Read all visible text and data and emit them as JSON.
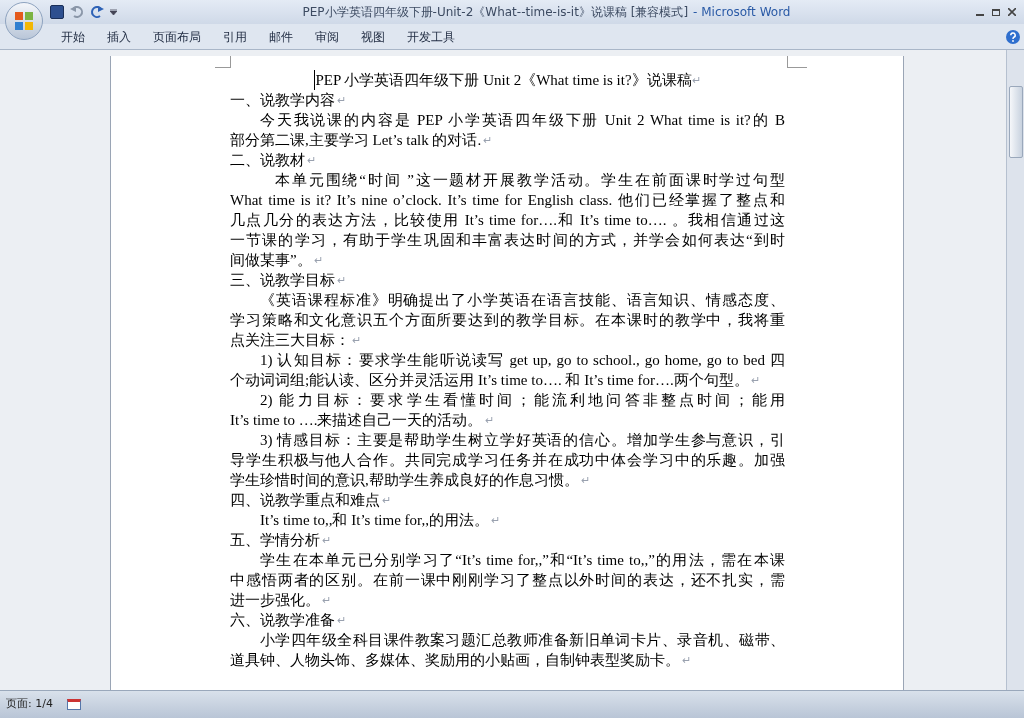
{
  "window": {
    "title": "PEP小学英语四年级下册-Unit-2《What--time-is-it》说课稿 [兼容模式]",
    "app_name": "- Microsoft Word"
  },
  "ribbon_tabs": [
    {
      "label": "开始",
      "selected": false
    },
    {
      "label": "插入",
      "selected": false
    },
    {
      "label": "页面布局",
      "selected": false
    },
    {
      "label": "引用",
      "selected": false
    },
    {
      "label": "邮件",
      "selected": false
    },
    {
      "label": "审阅",
      "selected": false
    },
    {
      "label": "视图",
      "selected": false
    },
    {
      "label": "开发工具",
      "selected": false
    }
  ],
  "document": {
    "paragraph_mark": "↵",
    "paragraphs": [
      {
        "kind": "title",
        "lines": [
          "PEP 小学英语四年级下册 Unit 2《What  time is it?》说课稿"
        ]
      },
      {
        "kind": "heading",
        "lines": [
          "一、说教学内容"
        ]
      },
      {
        "kind": "body",
        "lines": [
          "今天我说课的内容是  PEP  小学英语四年级下册 Unit 2  What  time is it?的  B",
          "部分第二课,主要学习 Let’s talk 的对话."
        ]
      },
      {
        "kind": "heading",
        "lines": [
          "二、说教材"
        ]
      },
      {
        "kind": "body_wide",
        "lines": [
          "本单元围绕“时间 ”这一题材开展教学活动。学生在前面课时学过句型",
          "What time is it? It’s nine o’clock. It’s time for English class. 他们已经掌握了整点和",
          "几点几分的表达方法，比较使用  It’s time for….和  It’s time to…. 。我相信通过这",
          "一节课的学习，有助于学生巩固和丰富表达时间的方式，并学会如何表达“到时",
          "间做某事”。"
        ]
      },
      {
        "kind": "heading",
        "lines": [
          "三、说教学目标"
        ]
      },
      {
        "kind": "body",
        "lines": [
          "《英语课程标准》明确提出了小学英语在语言技能、语言知识、情感态度、",
          "学习策略和文化意识五个方面所要达到的教学目标。在本课时的教学中，我将重",
          "点关注三大目标："
        ]
      },
      {
        "kind": "body",
        "lines": [
          "1) 认知目标：要求学生能听说读写 get up, go to school., go home, go to bed 四",
          "个动词词组;能认读、区分并灵活运用 It’s time to…. 和 It’s time for….两个句型。"
        ]
      },
      {
        "kind": "body",
        "lines": [
          "2) 能力目标：要求学生看懂时间；能流利地问答非整点时间；能用",
          "It’s time to ….来描述自己一天的活动。"
        ]
      },
      {
        "kind": "body",
        "lines": [
          "3) 情感目标：主要是帮助学生树立学好英语的信心。增加学生参与意识，引",
          "导学生积极与他人合作。共同完成学习任务并在成功中体会学习中的乐趣。加强",
          "学生珍惜时间的意识,帮助学生养成良好的作息习惯。"
        ]
      },
      {
        "kind": "heading",
        "lines": [
          "四、说教学重点和难点"
        ]
      },
      {
        "kind": "body",
        "lines": [
          "It’s time to,,和 It’s time for,,的用法。"
        ]
      },
      {
        "kind": "heading",
        "lines": [
          "五、学情分析"
        ]
      },
      {
        "kind": "body",
        "lines": [
          "学生在本单元已分别学习了“It’s time for,,”和“It’s time to,,”的用法，需在本课",
          "中感悟两者的区别。在前一课中刚刚学习了整点以外时间的表达，还不扎实，需",
          "进一步强化。"
        ]
      },
      {
        "kind": "heading",
        "lines": [
          "六、说教学准备"
        ]
      },
      {
        "kind": "body",
        "lines": [
          "小学四年级全科目课件教案习题汇总教师准备新旧单词卡片、录音机、磁带、",
          "道具钟、人物头饰、多媒体、奖励用的小贴画，自制钟表型奖励卡。"
        ]
      }
    ]
  },
  "status_bar": {
    "page": "页面: 1/4"
  }
}
